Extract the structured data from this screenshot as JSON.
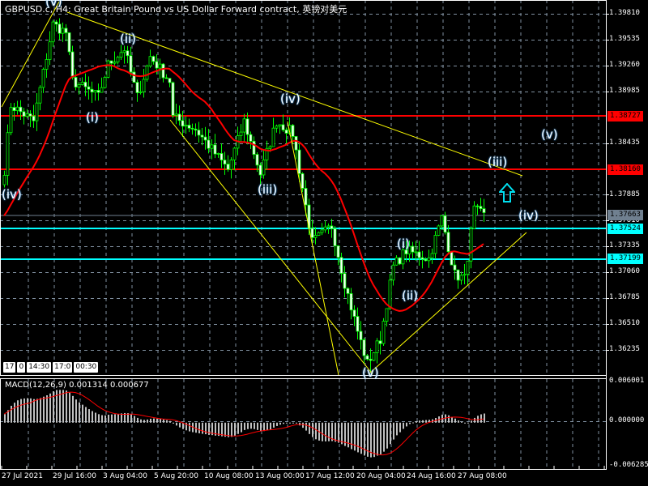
{
  "header": {
    "title": "GBPUSD.c, H4:  Great Britain Pound vs US Dollar Forward contract, 英镑对美元"
  },
  "macd": {
    "label": "MACD(12,26,9) 0.001314 0.000677",
    "axis_top": "0.006001",
    "axis_zero": "0.000000",
    "axis_bottom": "-0.006285"
  },
  "period_separators": [
    "17",
    "0",
    "14:30",
    "17:0",
    "00:30"
  ],
  "price_tags": {
    "resistance_1": "1.38727",
    "resistance_2": "1.38160",
    "current": "1.37663",
    "support_1": "1.37524",
    "support_2": "1.37199"
  },
  "wave_labels": [
    "(iv)",
    "(v)",
    "(i)",
    "(ii)",
    "(iii)",
    "(iv)",
    "(v)",
    "(i)",
    "(ii)",
    "(iii)",
    "(iv)",
    "(v)"
  ],
  "colors": {
    "bull": "#00ff00",
    "bear_body": "#ffffff",
    "ma": "#ff0000",
    "resistance": "#ff0000",
    "support": "#00ffff",
    "trendline": "#ffff00",
    "grid": "#8090a0",
    "hist": "#c0c0c0",
    "signal": "#ff0000"
  },
  "chart_data": {
    "type": "candlestick",
    "symbol": "GBPUSD.c",
    "timeframe": "H4",
    "yticks": [
      "1.39810",
      "1.39535",
      "1.39260",
      "1.38985",
      "1.38435",
      "1.37885",
      "1.37610",
      "1.37335",
      "1.37060",
      "1.36785",
      "1.36510",
      "1.36235"
    ],
    "ylim": [
      1.36235,
      1.3981
    ],
    "xticks": [
      "27 Jul 2021",
      "29 Jul 16:00",
      "3 Aug 04:00",
      "5 Aug 20:00",
      "10 Aug 08:00",
      "13 Aug 00:00",
      "17 Aug 12:00",
      "20 Aug 04:00",
      "24 Aug 16:00",
      "27 Aug 08:00"
    ],
    "bar_count": 149,
    "close_path": [
      [
        0,
        1.38152
      ],
      [
        2,
        1.38839
      ],
      [
        9,
        1.38667
      ],
      [
        15,
        1.39698
      ],
      [
        19,
        1.39612
      ],
      [
        21,
        1.39097
      ],
      [
        29,
        1.38925
      ],
      [
        32,
        1.39269
      ],
      [
        37,
        1.39441
      ],
      [
        41,
        1.38925
      ],
      [
        45,
        1.39355
      ],
      [
        51,
        1.39097
      ],
      [
        52,
        1.3871
      ],
      [
        59,
        1.38582
      ],
      [
        69,
        1.38152
      ],
      [
        74,
        1.38667
      ],
      [
        79,
        1.38109
      ],
      [
        84,
        1.38667
      ],
      [
        89,
        1.38539
      ],
      [
        95,
        1.37379
      ],
      [
        101,
        1.37551
      ],
      [
        105,
        1.36949
      ],
      [
        109,
        1.36434
      ],
      [
        112,
        1.36091
      ],
      [
        116,
        1.36348
      ],
      [
        120,
        1.37121
      ],
      [
        124,
        1.37293
      ],
      [
        131,
        1.37207
      ],
      [
        135,
        1.37637
      ],
      [
        139,
        1.37035
      ],
      [
        142,
        1.36992
      ],
      [
        145,
        1.37723
      ],
      [
        148,
        1.37663
      ]
    ],
    "horizontal_levels": [
      1.38727,
      1.3816,
      1.37524,
      1.37199
    ],
    "current_price": 1.37663,
    "macd_ylim": [
      -0.006285,
      0.006001
    ],
    "macd_params": [
      12,
      26,
      9
    ]
  }
}
